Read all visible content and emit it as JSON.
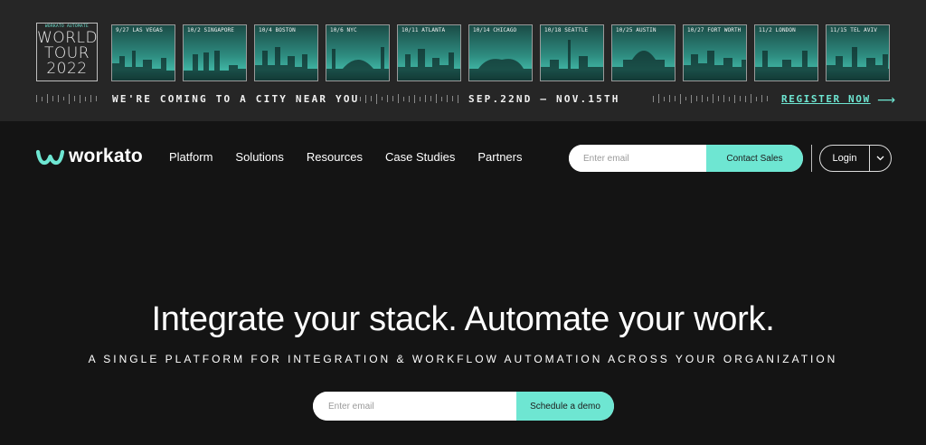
{
  "banner": {
    "logo": {
      "small": "WORKATO AUTOMATE",
      "line1": "WORLD",
      "line2": "TOUR",
      "line3": "2022"
    },
    "cities": [
      "9/27 LAS VEGAS",
      "10/2 SINGAPORE",
      "10/4 BOSTON",
      "10/6 NYC",
      "10/11 ATLANTA",
      "10/14 CHICAGO",
      "10/18 SEATTLE",
      "10/25 AUSTIN",
      "10/27 FORT WORTH",
      "11/2 LONDON",
      "11/15 TEL AVIV"
    ],
    "tagline": "WE'RE COMING TO A CITY NEAR YOU",
    "dates": "SEP.22ND — NOV.15TH",
    "register": "REGISTER NOW",
    "register_icon": "arrow-right-icon"
  },
  "nav": {
    "brand": "workato",
    "links": [
      "Platform",
      "Solutions",
      "Resources",
      "Case Studies",
      "Partners"
    ],
    "email_placeholder": "Enter email",
    "contact_label": "Contact Sales",
    "login_label": "Login",
    "login_dropdown_icon": "chevron-down-icon"
  },
  "hero": {
    "title": "Integrate your stack. Automate your work.",
    "subtitle": "A SINGLE PLATFORM FOR INTEGRATION & WORKFLOW AUTOMATION ACROSS YOUR ORGANIZATION",
    "email_placeholder": "Enter email",
    "cta_label": "Schedule a demo"
  },
  "colors": {
    "accent": "#6ee6d2",
    "background": "#141414",
    "banner_background": "#262626"
  }
}
